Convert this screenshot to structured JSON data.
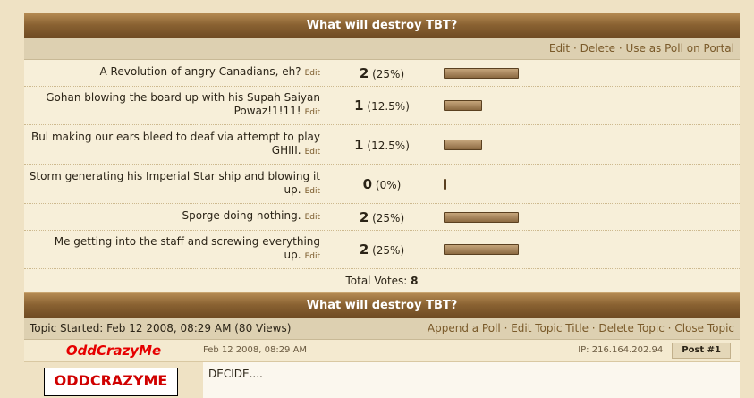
{
  "poll": {
    "title": "What will destroy TBT?",
    "actions": [
      "Edit",
      "Delete",
      "Use as Poll on Portal"
    ],
    "edit_label": "Edit",
    "options": [
      {
        "text": "A Revolution of angry Canadians, eh?",
        "votes": "2",
        "percent": "(25%)",
        "fraction": 0.25
      },
      {
        "text": "Gohan blowing the board up with his Supah Saiyan Powaz!1!11!",
        "votes": "1",
        "percent": "(12.5%)",
        "fraction": 0.125
      },
      {
        "text": "Bul making our ears bleed to deaf via attempt to play GHIII.",
        "votes": "1",
        "percent": "(12.5%)",
        "fraction": 0.125
      },
      {
        "text": "Storm generating his Imperial Star ship and blowing it up.",
        "votes": "0",
        "percent": "(0%)",
        "fraction": 0
      },
      {
        "text": "Sporge doing nothing.",
        "votes": "2",
        "percent": "(25%)",
        "fraction": 0.25
      },
      {
        "text": "Me getting into the staff and screwing everything up.",
        "votes": "2",
        "percent": "(25%)",
        "fraction": 0.25
      }
    ],
    "total_label": "Total Votes:",
    "total": "8"
  },
  "topic": {
    "title": "What will destroy TBT?",
    "started": "Topic Started: Feb 12 2008, 08:29 AM (80 Views)",
    "actions": [
      "Append a Poll",
      "Edit Topic Title",
      "Delete Topic",
      "Close Topic"
    ]
  },
  "post": {
    "author": "OddCrazyMe",
    "date": "Feb 12 2008, 08:29 AM",
    "ip": "IP: 216.164.202.94",
    "post_number": "Post #1",
    "avatar_text": "ODDCRAZYME",
    "body": "DECIDE...."
  }
}
